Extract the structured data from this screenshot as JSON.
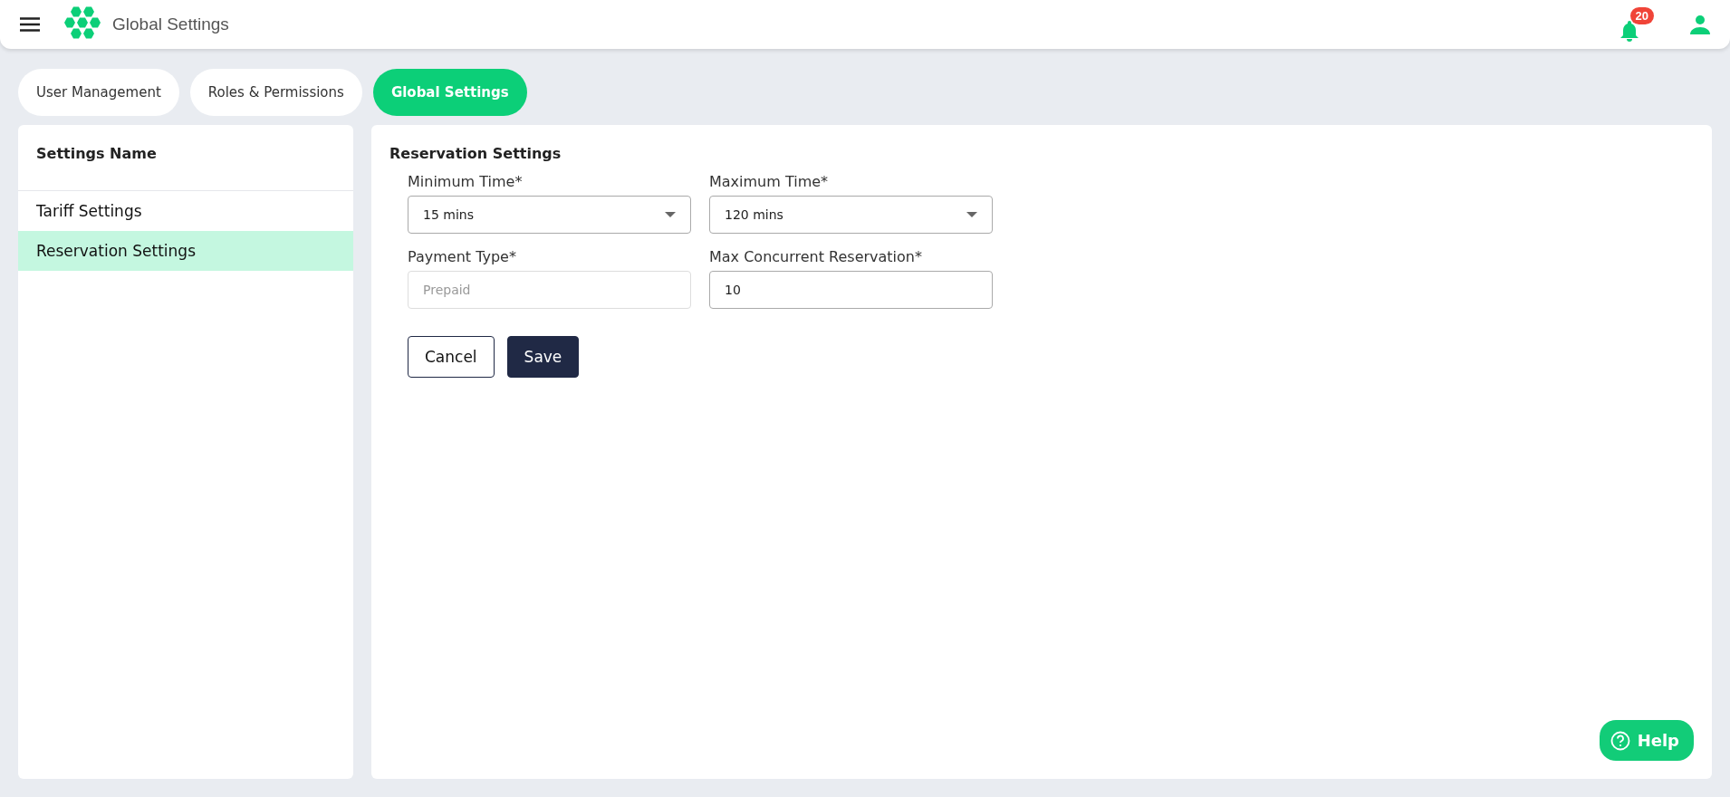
{
  "header": {
    "title": "Global Settings",
    "notifications": "20"
  },
  "tabs": [
    {
      "label": "User Management",
      "selected": false
    },
    {
      "label": "Roles & Permissions",
      "selected": false
    },
    {
      "label": "Global Settings",
      "selected": true
    }
  ],
  "sidebar": {
    "title": "Settings Name",
    "items": [
      {
        "label": "Tariff Settings",
        "selected": false
      },
      {
        "label": "Reservation Settings",
        "selected": true
      }
    ]
  },
  "form": {
    "title": "Reservation Settings",
    "fields": [
      {
        "kind": "select",
        "label": "Minimum Time*",
        "value": "15 mins"
      },
      {
        "kind": "select",
        "label": "Maximum Time*",
        "value": "120 mins"
      },
      {
        "kind": "input",
        "label": "Payment Type*",
        "placeholder": "Prepaid"
      },
      {
        "kind": "input",
        "label": "Max Concurrent Reservation*",
        "value": "10"
      }
    ],
    "buttons": [
      {
        "kind": "secondary",
        "label": "Cancel"
      },
      {
        "kind": "primary",
        "label": "Save"
      }
    ]
  },
  "help": {
    "label": "Help"
  }
}
